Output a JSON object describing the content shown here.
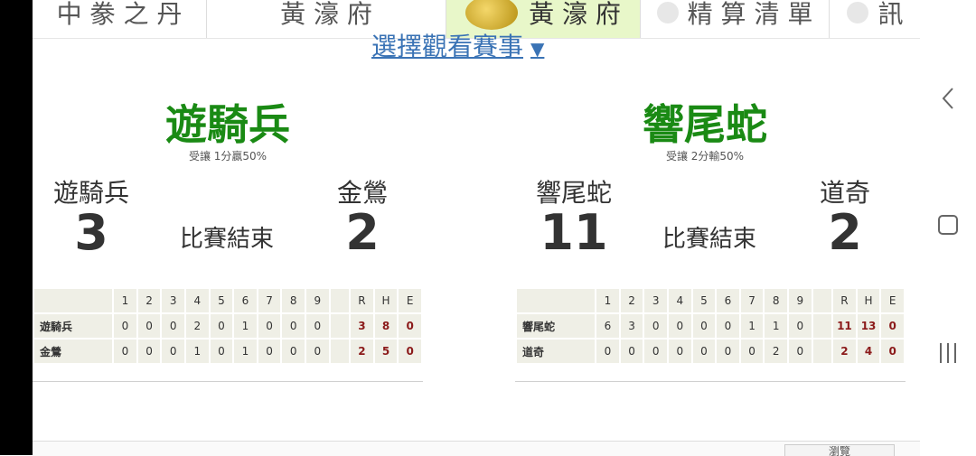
{
  "tabs": [
    {
      "label": "中 豢 之 丹",
      "active": false
    },
    {
      "label": "黃 濠 府",
      "active": true
    },
    {
      "label": "精 算 清 單",
      "active": false
    },
    {
      "label": "訊",
      "active": false
    }
  ],
  "choose_link": {
    "label": "選擇觀看賽事",
    "arrow": "▼"
  },
  "games": [
    {
      "pick_team": "遊騎兵",
      "pick_note": "受讓 1分贏50%",
      "away": {
        "name": "遊騎兵",
        "score": "3"
      },
      "home": {
        "name": "金鶯",
        "score": "2"
      },
      "status": "比賽結束",
      "box": {
        "header": [
          "1",
          "2",
          "3",
          "4",
          "5",
          "6",
          "7",
          "8",
          "9",
          "R",
          "H",
          "E"
        ],
        "rows": [
          {
            "team": "遊騎兵",
            "innings": [
              "0",
              "0",
              "0",
              "2",
              "0",
              "1",
              "0",
              "0",
              "0"
            ],
            "R": "3",
            "H": "8",
            "E": "0"
          },
          {
            "team": "金鶯",
            "innings": [
              "0",
              "0",
              "0",
              "1",
              "0",
              "1",
              "0",
              "0",
              "0"
            ],
            "R": "2",
            "H": "5",
            "E": "0"
          }
        ]
      }
    },
    {
      "pick_team": "響尾蛇",
      "pick_note": "受讓 2分輸50%",
      "away": {
        "name": "響尾蛇",
        "score": "11"
      },
      "home": {
        "name": "道奇",
        "score": "2"
      },
      "status": "比賽結束",
      "box": {
        "header": [
          "1",
          "2",
          "3",
          "4",
          "5",
          "6",
          "7",
          "8",
          "9",
          "R",
          "H",
          "E"
        ],
        "rows": [
          {
            "team": "響尾蛇",
            "innings": [
              "6",
              "3",
              "0",
              "0",
              "0",
              "0",
              "1",
              "1",
              "0"
            ],
            "R": "11",
            "H": "13",
            "E": "0"
          },
          {
            "team": "道奇",
            "innings": [
              "0",
              "0",
              "0",
              "0",
              "0",
              "0",
              "0",
              "2",
              "0"
            ],
            "R": "2",
            "H": "4",
            "E": "0"
          }
        ]
      }
    }
  ],
  "bottom_button": "瀏覽",
  "colors": {
    "pick_green": "#1a8a14",
    "rhe_red": "#8b1a1a",
    "link_blue": "#3a73b5",
    "active_tab": "#e8f7c9"
  }
}
